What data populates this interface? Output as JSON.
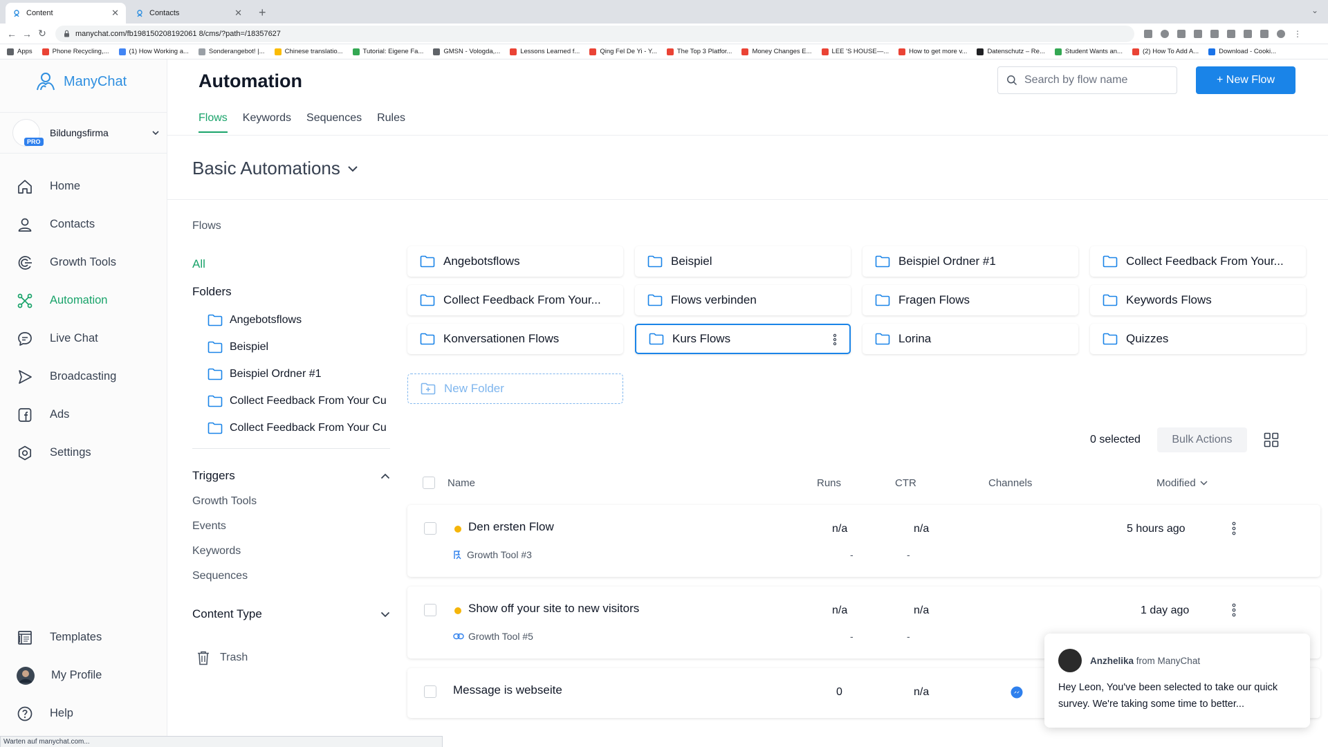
{
  "browser": {
    "tabs": [
      {
        "label": "Content",
        "active": true
      },
      {
        "label": "Contacts",
        "active": false
      }
    ],
    "url": "manychat.com/fb198150208192061 8/cms/?path=/18357627",
    "bookmarks": [
      "Apps",
      "Phone Recycling,...",
      "(1) How Working a...",
      "Sonderangebot! |...",
      "Chinese translatio...",
      "Tutorial: Eigene Fa...",
      "GMSN - Vologda,...",
      "Lessons Learned f...",
      "Qing Fel De Yi - Y...",
      "The Top 3 Platfor...",
      "Money Changes E...",
      "LEE 'S HOUSE—...",
      "How to get more v...",
      "Datenschutz – Re...",
      "Student Wants an...",
      "(2) How To Add A...",
      "Download - Cooki..."
    ],
    "status_text": "Warten auf manychat.com..."
  },
  "sidebar": {
    "brand": "ManyChat",
    "account_name": "Bildungsfirma",
    "pro_badge": "PRO",
    "nav": [
      {
        "label": "Home",
        "icon": "home-icon"
      },
      {
        "label": "Contacts",
        "icon": "user-icon"
      },
      {
        "label": "Growth Tools",
        "icon": "growth-icon"
      },
      {
        "label": "Automation",
        "icon": "automation-icon",
        "active": true
      },
      {
        "label": "Live Chat",
        "icon": "chat-icon"
      },
      {
        "label": "Broadcasting",
        "icon": "send-icon"
      },
      {
        "label": "Ads",
        "icon": "ads-icon"
      },
      {
        "label": "Settings",
        "icon": "gear-icon"
      }
    ],
    "nav_bottom": [
      {
        "label": "Templates",
        "icon": "templates-icon"
      },
      {
        "label": "My Profile",
        "icon": "avatar"
      },
      {
        "label": "Help",
        "icon": "help-icon"
      }
    ]
  },
  "header": {
    "title": "Automation",
    "tabs": [
      "Flows",
      "Keywords",
      "Sequences",
      "Rules"
    ],
    "active_tab": "Flows",
    "search_placeholder": "Search by flow name",
    "new_flow_label": "+ New Flow"
  },
  "section_title": "Basic Automations",
  "left_panel": {
    "flows_label": "Flows",
    "all_label": "All",
    "folders_heading": "Folders",
    "folders": [
      "Angebotsflows",
      "Beispiel",
      "Beispiel Ordner #1",
      "Collect Feedback From Your Cu",
      "Collect Feedback From Your Cu"
    ],
    "triggers_heading": "Triggers",
    "triggers": [
      "Growth Tools",
      "Events",
      "Keywords",
      "Sequences"
    ],
    "content_type_heading": "Content Type",
    "trash_label": "Trash"
  },
  "folder_cards": [
    "Angebotsflows",
    "Beispiel",
    "Beispiel Ordner #1",
    "Collect Feedback From Your...",
    "Collect Feedback From Your...",
    "Flows verbinden",
    "Fragen Flows",
    "Keywords Flows",
    "Konversationen Flows",
    "Kurs Flows",
    "Lorina",
    "Quizzes"
  ],
  "new_folder_label": "New Folder",
  "selection": {
    "count_label": "0 selected",
    "bulk_actions_label": "Bulk Actions"
  },
  "table": {
    "columns": [
      "Name",
      "Runs",
      "CTR",
      "Channels",
      "Modified"
    ],
    "rows": [
      {
        "name": "Den ersten Flow",
        "trigger": "Growth Tool #3",
        "runs": "n/a",
        "ctr": "n/a",
        "runs_sub": "-",
        "ctr_sub": "-",
        "modified": "5 hours ago"
      },
      {
        "name": "Show off your site to new visitors",
        "trigger": "Growth Tool #5",
        "runs": "n/a",
        "ctr": "n/a",
        "runs_sub": "-",
        "ctr_sub": "-",
        "modified": "1 day ago"
      },
      {
        "name": "Message is webseite",
        "runs": "0",
        "ctr": "n/a"
      }
    ]
  },
  "chat_popup": {
    "sender": "Anzhelika",
    "from_text": "from ManyChat",
    "message": "Hey Leon,  You've been selected to take our quick survey. We're taking some time to better..."
  },
  "colors": {
    "accent_green": "#19a36a",
    "primary_blue": "#1a84e8",
    "draft_dot": "#f5b50a"
  }
}
